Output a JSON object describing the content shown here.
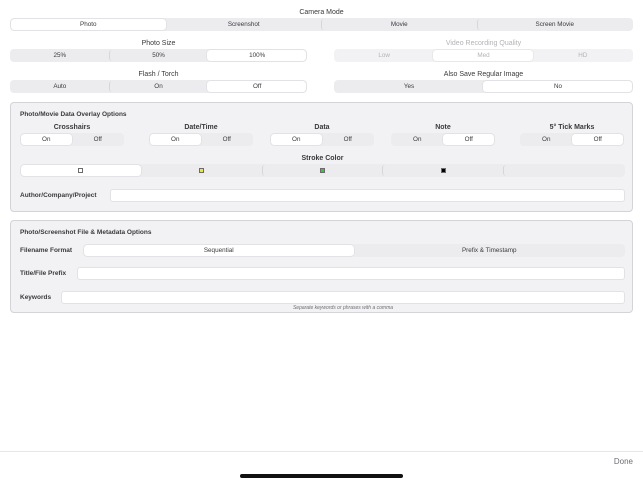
{
  "camera_mode": {
    "label": "Camera Mode",
    "options": [
      "Photo",
      "Screenshot",
      "Movie",
      "Screen Movie"
    ],
    "selected": 0
  },
  "photo_size": {
    "label": "Photo Size",
    "options": [
      "25%",
      "50%",
      "100%"
    ],
    "selected": 2
  },
  "video_quality": {
    "label": "Video Recording Quality",
    "options": [
      "Low",
      "Med",
      "HD"
    ],
    "selected": 1,
    "disabled": true
  },
  "flash": {
    "label": "Flash / Torch",
    "options": [
      "Auto",
      "On",
      "Off"
    ],
    "selected": 2
  },
  "save_regular": {
    "label": "Also Save Regular Image",
    "options": [
      "Yes",
      "No"
    ],
    "selected": 1
  },
  "overlay": {
    "title": "Photo/Movie Data Overlay Options",
    "toggles": [
      {
        "label": "Crosshairs",
        "options": [
          "On",
          "Off"
        ],
        "selected": 0
      },
      {
        "label": "Date/Time",
        "options": [
          "On",
          "Off"
        ],
        "selected": 0
      },
      {
        "label": "Data",
        "options": [
          "On",
          "Off"
        ],
        "selected": 0
      },
      {
        "label": "Note",
        "options": [
          "On",
          "Off"
        ],
        "selected": 1
      },
      {
        "label": "5° Tick Marks",
        "options": [
          "On",
          "Off"
        ],
        "selected": 1
      }
    ],
    "stroke_color": {
      "label": "Stroke Color",
      "colors": [
        "#ffffff",
        "#e8e63a",
        "#3cc43c",
        "#000000",
        "#000000"
      ],
      "selected": 0
    },
    "author_label": "Author/Company/Project",
    "author_value": ""
  },
  "file_meta": {
    "title": "Photo/Screenshot File & Metadata Options",
    "filename_format": {
      "label": "Filename Format",
      "options": [
        "Sequential",
        "Prefix & Timestamp"
      ],
      "selected": 0
    },
    "prefix_label": "Title/File Prefix",
    "prefix_value": "",
    "keywords_label": "Keywords",
    "keywords_value": "",
    "keywords_hint": "Separate keywords or phrases with a comma"
  },
  "footer": {
    "done_label": "Done"
  }
}
